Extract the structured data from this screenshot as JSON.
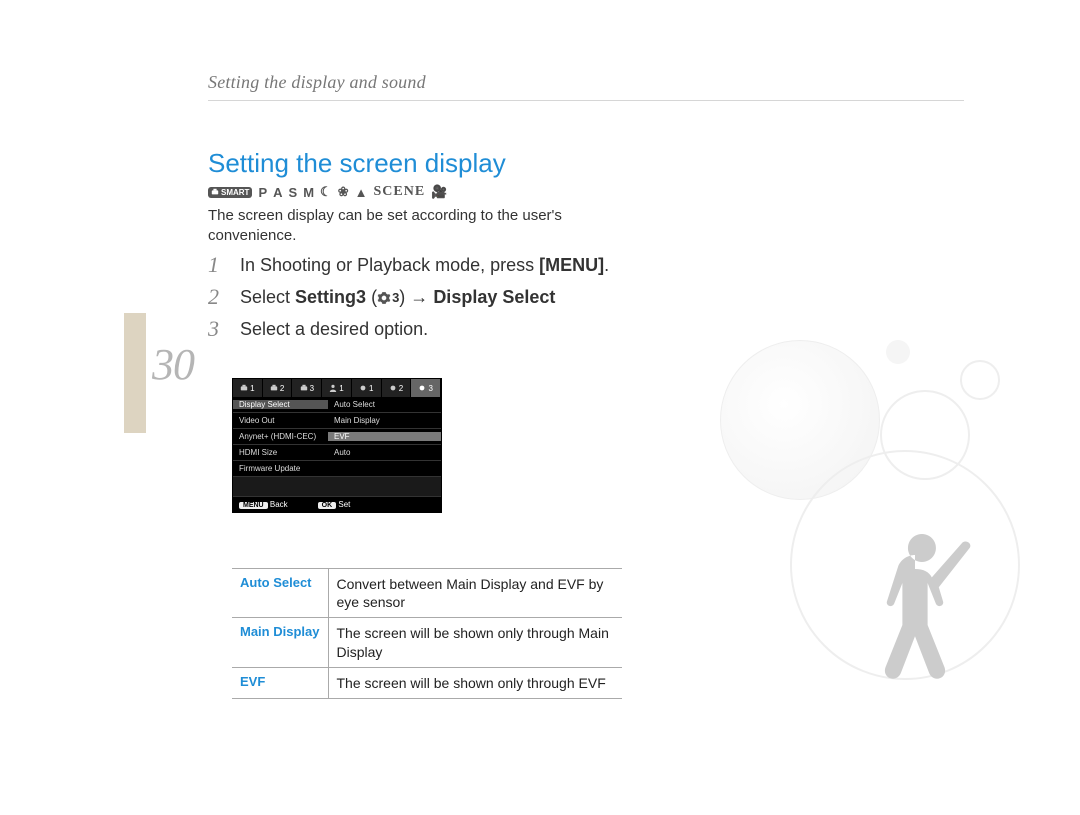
{
  "header": {
    "breadcrumb": "Setting the display and sound"
  },
  "page_number": "30",
  "section": {
    "title": "Setting the screen display",
    "mode_strip": {
      "smart_label": "SMART",
      "modes": [
        "P",
        "A",
        "S",
        "M"
      ],
      "scene_label": "SCENE"
    },
    "intro": "The screen display can be set according to the user's convenience."
  },
  "steps": [
    {
      "num": "1",
      "text_pre": "In Shooting or Playback mode, press ",
      "bold1": "[MENU]",
      "text_post": "."
    },
    {
      "num": "2",
      "select_label": "Select ",
      "setting_label": "Setting3",
      "gear_number": "3",
      "arrow": " → ",
      "target_label": "Display Select"
    },
    {
      "num": "3",
      "text": "Select a desired option."
    }
  ],
  "camera_menu": {
    "tabs": [
      {
        "icon": "camera",
        "num": "1"
      },
      {
        "icon": "camera",
        "num": "2"
      },
      {
        "icon": "camera",
        "num": "3"
      },
      {
        "icon": "user",
        "num": "1"
      },
      {
        "icon": "gear",
        "num": "1"
      },
      {
        "icon": "gear",
        "num": "2"
      },
      {
        "icon": "gear",
        "num": "3",
        "active": true
      }
    ],
    "rows": [
      {
        "left": "Display Select",
        "right": "Auto Select",
        "selected": true
      },
      {
        "left": "Video Out",
        "right": "Main Display"
      },
      {
        "left": "Anynet+ (HDMI-CEC)",
        "right": "EVF",
        "opt_hl": true
      },
      {
        "left": "HDMI Size",
        "right": "Auto"
      },
      {
        "left": "Firmware Update",
        "right": ""
      }
    ],
    "footer": {
      "back_btn": "MENU",
      "back_label": "Back",
      "ok_btn": "OK",
      "ok_label": "Set"
    }
  },
  "options_table": [
    {
      "name": "Auto Select",
      "desc": "Convert between Main Display and EVF by eye sensor"
    },
    {
      "name": "Main Display",
      "desc": "The screen will be shown only through Main Display"
    },
    {
      "name": "EVF",
      "desc": "The screen will be shown only through EVF"
    }
  ]
}
